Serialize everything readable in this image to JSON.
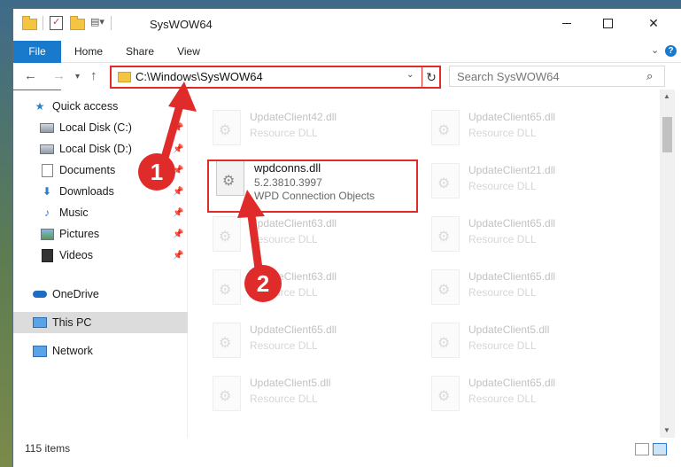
{
  "window": {
    "title": "SysWOW64"
  },
  "ribbon": {
    "tabs": [
      "File",
      "Home",
      "Share",
      "View"
    ]
  },
  "navbar": {
    "address": "C:\\Windows\\SysWOW64",
    "search_placeholder": "Search SysWOW64"
  },
  "sidebar": {
    "items": [
      {
        "label": "Quick access",
        "icon": "star-icon"
      },
      {
        "label": "Local Disk (C:)",
        "icon": "disk-icon",
        "pinned": true
      },
      {
        "label": "Local Disk (D:)",
        "icon": "disk-icon",
        "pinned": true
      },
      {
        "label": "Documents",
        "icon": "documents-icon",
        "pinned": true
      },
      {
        "label": "Downloads",
        "icon": "download-icon",
        "pinned": true
      },
      {
        "label": "Music",
        "icon": "music-icon",
        "pinned": true
      },
      {
        "label": "Pictures",
        "icon": "pictures-icon",
        "pinned": true
      },
      {
        "label": "Videos",
        "icon": "videos-icon",
        "pinned": true
      },
      {
        "label": "OneDrive",
        "icon": "cloud-icon"
      },
      {
        "label": "This PC",
        "icon": "computer-icon",
        "selected": true
      },
      {
        "label": "Network",
        "icon": "network-icon"
      }
    ]
  },
  "files": {
    "highlighted": {
      "name": "wpdconns.dll",
      "version": "5.2.3810.3997",
      "description": "WPD Connection Objects"
    },
    "left_column": [
      {
        "name": "UpdateClient42.dll",
        "desc": "Resource DLL"
      },
      {
        "name": "UpdateClient63.dll",
        "desc": "Resource DLL"
      },
      {
        "name": "UpdateClient63.dll",
        "desc": "Resource DLL"
      },
      {
        "name": "UpdateClient65.dll",
        "desc": "Resource DLL"
      },
      {
        "name": "UpdateClient5.dll",
        "desc": "Resource DLL"
      }
    ],
    "right_column": [
      {
        "name": "UpdateClient65.dll",
        "desc": "Resource DLL"
      },
      {
        "name": "UpdateClient21.dll",
        "desc": "Resource DLL"
      },
      {
        "name": "UpdateClient65.dll",
        "desc": "Resource DLL"
      },
      {
        "name": "UpdateClient65.dll",
        "desc": "Resource DLL"
      },
      {
        "name": "UpdateClient5.dll",
        "desc": "Resource DLL"
      },
      {
        "name": "UpdateClient65.dll",
        "desc": "Resource DLL"
      }
    ]
  },
  "status": {
    "item_count": "115 items"
  },
  "annotations": {
    "step1": "1",
    "step2": "2",
    "color": "#e02b2b"
  }
}
